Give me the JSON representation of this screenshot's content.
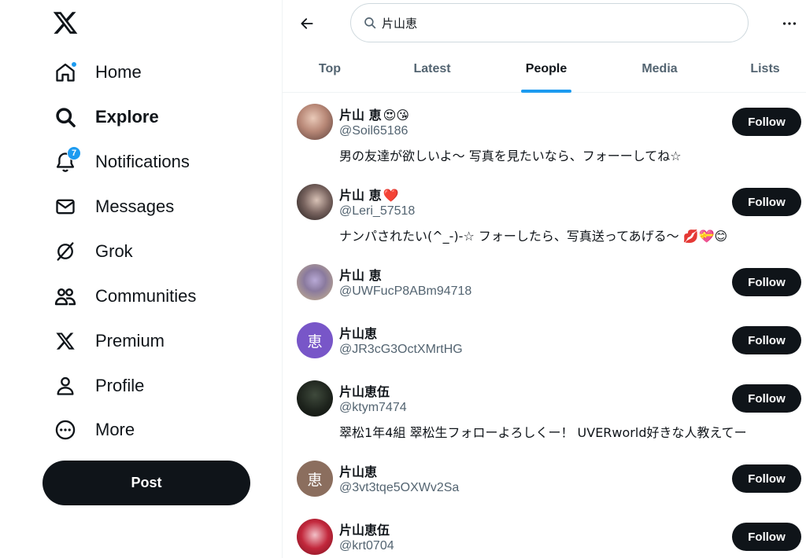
{
  "sidebar": {
    "logo": "x-logo-icon",
    "nav": [
      {
        "label": "Home",
        "icon": "home-icon"
      },
      {
        "label": "Explore",
        "icon": "search-icon"
      },
      {
        "label": "Notifications",
        "icon": "bell-icon",
        "badge": "7"
      },
      {
        "label": "Messages",
        "icon": "envelope-icon"
      },
      {
        "label": "Grok",
        "icon": "grok-icon"
      },
      {
        "label": "Communities",
        "icon": "people-icon"
      },
      {
        "label": "Premium",
        "icon": "x-logo-icon"
      },
      {
        "label": "Profile",
        "icon": "person-icon"
      },
      {
        "label": "More",
        "icon": "more-circle-icon"
      }
    ],
    "post_label": "Post"
  },
  "search": {
    "query": "片山恵"
  },
  "tabs": [
    "Top",
    "Latest",
    "People",
    "Media",
    "Lists"
  ],
  "results": [
    {
      "name": "片山 恵",
      "emoji": "😍😘",
      "handle": "@Soil65186",
      "bio": "男の友達が欲しいよ〜 写真を見たいなら、フォーーしてね☆",
      "follow": "Follow"
    },
    {
      "name": "片山 恵",
      "emoji": "❤️",
      "handle": "@Leri_57518",
      "bio": "ナンパされたい(^_-)-☆ フォーしたら、写真送ってあげる〜 💋💝😊",
      "follow": "Follow"
    },
    {
      "name": "片山 恵",
      "emoji": "",
      "handle": "@UWFucP8ABm94718",
      "bio": "",
      "follow": "Follow"
    },
    {
      "name": "片山恵",
      "emoji": "",
      "handle": "@JR3cG3OctXMrtHG",
      "bio": "",
      "follow": "Follow",
      "avatar_letter": "恵"
    },
    {
      "name": "片山恵伍",
      "emoji": "",
      "handle": "@ktym7474",
      "bio": "翠松1年4組 翠松生フォローよろしくー！ UVERworld好きな人教えてー",
      "follow": "Follow"
    },
    {
      "name": "片山恵",
      "emoji": "",
      "handle": "@3vt3tqe5OXWv2Sa",
      "bio": "",
      "follow": "Follow",
      "avatar_letter": "恵"
    },
    {
      "name": "片山恵伍",
      "emoji": "",
      "handle": "@krt0704",
      "bio": "",
      "follow": "Follow"
    }
  ],
  "colors": {
    "accent": "#1d9bf0",
    "text": "#0f1419",
    "muted": "#536471",
    "avatar_purple": "#7856c8",
    "avatar_brown": "#8b6e5e"
  }
}
